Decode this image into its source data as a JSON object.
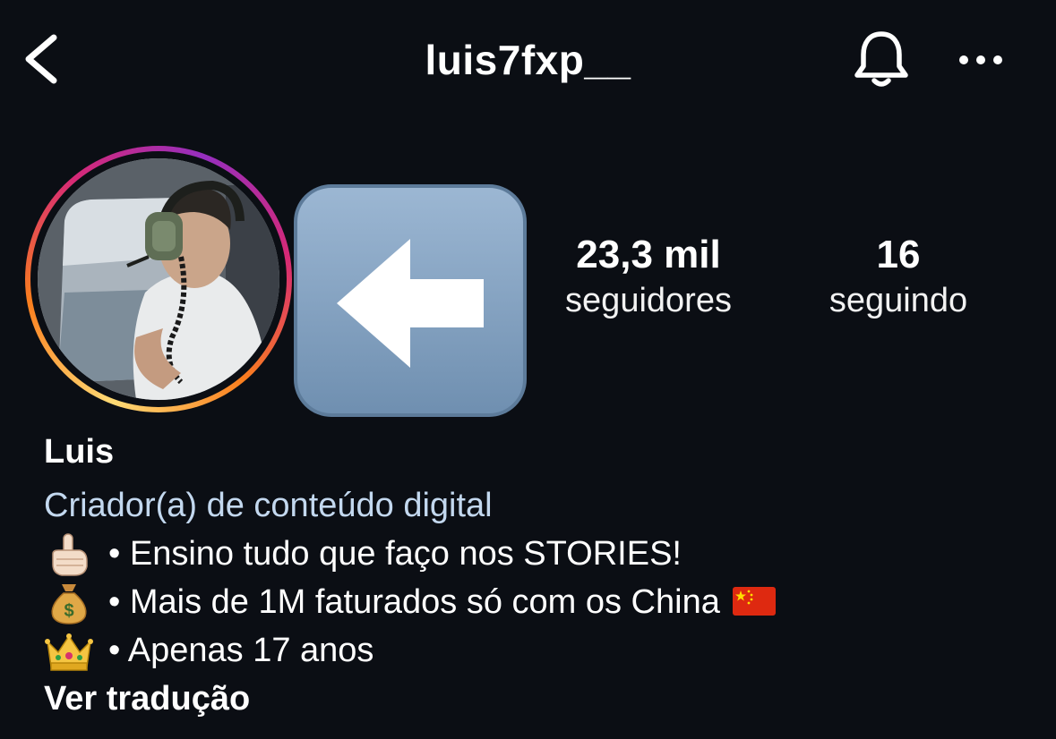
{
  "header": {
    "username": "luis7fxp__",
    "back_icon": "chevron-left-icon",
    "notification_icon": "bell-icon",
    "more_icon": "ellipsis-icon"
  },
  "profile": {
    "avatar": "profile-photo",
    "story_ring_colors": [
      "#feda75",
      "#fa7e1e",
      "#d62976",
      "#962fbf"
    ],
    "highlight_emoji": "left-arrow-emoji",
    "stats": {
      "followers_count": "23,3 mil",
      "followers_label": "seguidores",
      "following_count": "16",
      "following_label": "seguindo"
    }
  },
  "bio": {
    "name": "Luis",
    "category": "Criador(a) de conteúdo digital",
    "lines": [
      {
        "icon": "pointing-up-emoji",
        "text": "• Ensino tudo que faço nos STORIES!"
      },
      {
        "icon": "money-bag-emoji",
        "text": "• Mais de 1M faturados só com os China",
        "trailing_icon": "china-flag-emoji"
      },
      {
        "icon": "crown-emoji",
        "text": "• Apenas 17 anos"
      }
    ],
    "translate_label": "Ver tradução"
  },
  "colors": {
    "background": "#0b0e14",
    "text": "#ffffff",
    "category_text": "#c3d8ef"
  }
}
